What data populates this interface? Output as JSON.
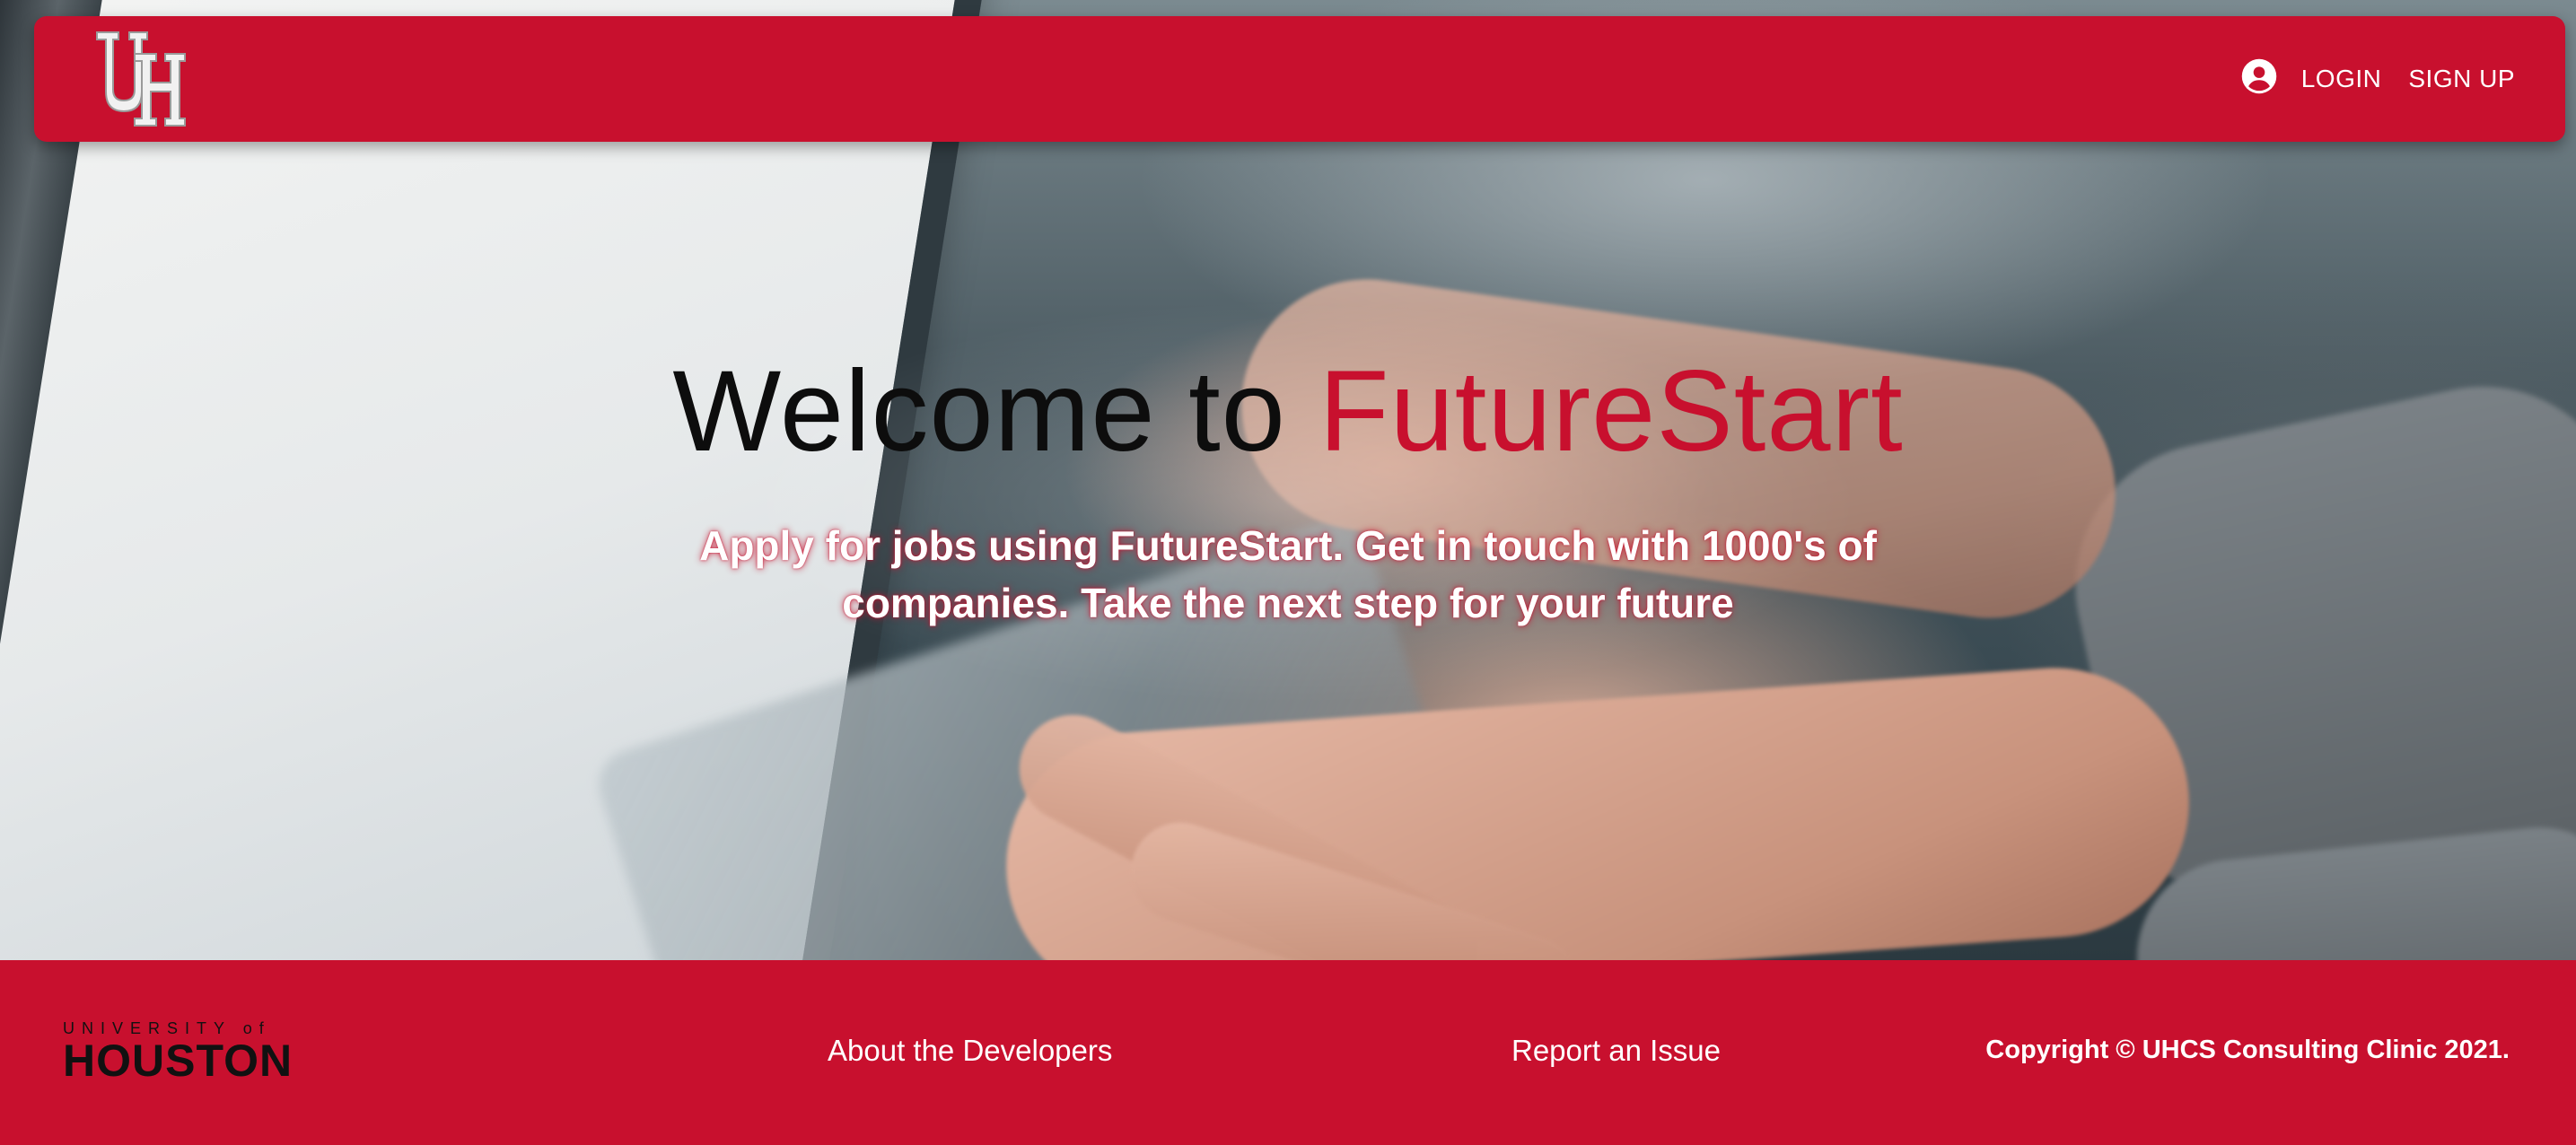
{
  "header": {
    "login_label": "LOGIN",
    "signup_label": "SIGN UP",
    "logo_text": "UH"
  },
  "hero": {
    "title_prefix": "Welcome to ",
    "title_accent": "FutureStart",
    "subtitle": "Apply for jobs using FutureStart. Get in touch with 1000's of companies. Take the next step for your future"
  },
  "footer": {
    "university_small": "UNIVERSITY of",
    "university_big": "HOUSTON",
    "about_label": "About the Developers",
    "report_label": "Report an Issue",
    "copyright": "Copyright © UHCS Consulting Clinic 2021."
  },
  "colors": {
    "brand_red": "#c8102e",
    "title_dark": "#0d0d0d",
    "white": "#ffffff"
  },
  "icons": {
    "account": "account-circle-icon",
    "logo": "uh-logo-icon"
  }
}
